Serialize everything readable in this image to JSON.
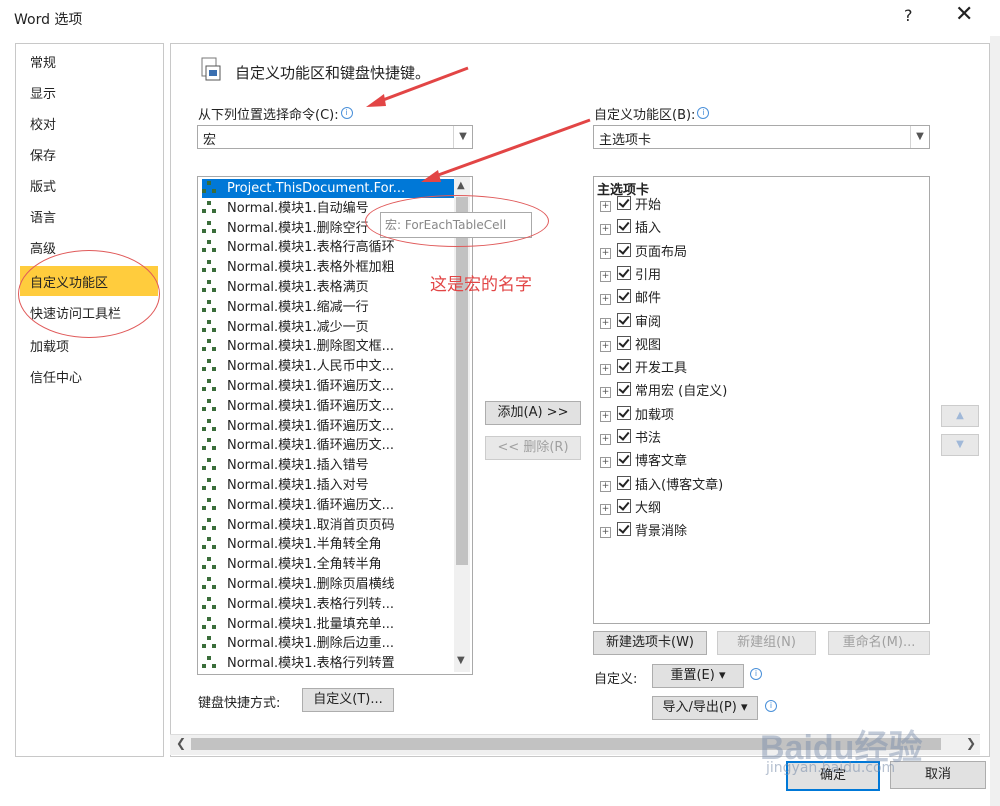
{
  "window": {
    "title": "Word 选项",
    "help": "?",
    "close": "✕"
  },
  "nav": {
    "items": [
      "常规",
      "显示",
      "校对",
      "保存",
      "版式",
      "语言",
      "高级",
      "自定义功能区",
      "快速访问工具栏",
      "加载项",
      "信任中心"
    ],
    "selected_index": 7
  },
  "header": {
    "title": "自定义功能区和键盘快捷键。"
  },
  "left": {
    "label": "从下列位置选择命令(C):",
    "combo_value": "宏",
    "items": [
      "Project.ThisDocument.For...",
      "Normal.模块1.自动编号",
      "Normal.模块1.删除空行",
      "Normal.模块1.表格行高循环",
      "Normal.模块1.表格外框加粗",
      "Normal.模块1.表格满页",
      "Normal.模块1.缩减一行",
      "Normal.模块1.减少一页",
      "Normal.模块1.删除图文框...",
      "Normal.模块1.人民币中文...",
      "Normal.模块1.循环遍历文...",
      "Normal.模块1.循环遍历文...",
      "Normal.模块1.循环遍历文...",
      "Normal.模块1.循环遍历文...",
      "Normal.模块1.插入错号",
      "Normal.模块1.插入对号",
      "Normal.模块1.循环遍历文...",
      "Normal.模块1.取消首页页码",
      "Normal.模块1.半角转全角",
      "Normal.模块1.全角转半角",
      "Normal.模块1.删除页眉横线",
      "Normal.模块1.表格行列转...",
      "Normal.模块1.批量填充单...",
      "Normal.模块1.删除后边重...",
      "Normal.模块1.表格行列转置"
    ],
    "tooltip": "宏: ForEachTableCell"
  },
  "middle": {
    "add_label": "添加(A) >>",
    "remove_label": "<< 删除(R)"
  },
  "right": {
    "label": "自定义功能区(B):",
    "combo_value": "主选项卡",
    "tree_header": "主选项卡",
    "tabs": [
      "开始",
      "插入",
      "页面布局",
      "引用",
      "邮件",
      "审阅",
      "视图",
      "开发工具",
      "常用宏 (自定义)",
      "加载项",
      "书法",
      "博客文章",
      "插入(博客文章)",
      "大纲",
      "背景消除"
    ],
    "new_tab": "新建选项卡(W)",
    "new_group": "新建组(N)",
    "rename": "重命名(M)...",
    "customize_label": "自定义:",
    "reset": "重置(E) ▾",
    "import_export": "导入/导出(P) ▾"
  },
  "keyboard": {
    "label": "键盘快捷方式:",
    "button": "自定义(T)..."
  },
  "footer": {
    "ok": "确定",
    "cancel": "取消"
  },
  "annotation": {
    "text": "这是宏的名字",
    "color": "#e24545"
  },
  "watermark": {
    "main": "Baidu经验",
    "sub": "jingyan.baidu.com"
  },
  "colors": {
    "selection": "#0078d7",
    "nav_highlight": "#ffcc3d"
  }
}
